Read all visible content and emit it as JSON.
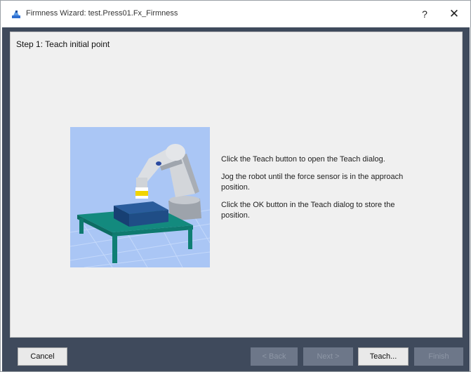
{
  "window": {
    "title": "Firmness Wizard: test.Press01.Fx_Firmness",
    "help_label": "?",
    "close_label": "✕"
  },
  "step": {
    "title": "Step 1: Teach initial point"
  },
  "instructions": [
    "Click the Teach button to open the Teach dialog.",
    "Jog the robot until the force sensor is in the approach position.",
    "Click the OK button in the Teach dialog to store the position."
  ],
  "buttons": {
    "cancel": "Cancel",
    "back": "< Back",
    "next": "Next >",
    "teach": "Teach...",
    "finish": "Finish"
  },
  "colors": {
    "frame": "#3f4a5c",
    "panel": "#f0f0f0",
    "illustration_bg": "#aac6f5",
    "table": "#0f7f74",
    "block": "#1f4d86",
    "sensor": "#f0d400",
    "robot": "#c8ccd2"
  }
}
